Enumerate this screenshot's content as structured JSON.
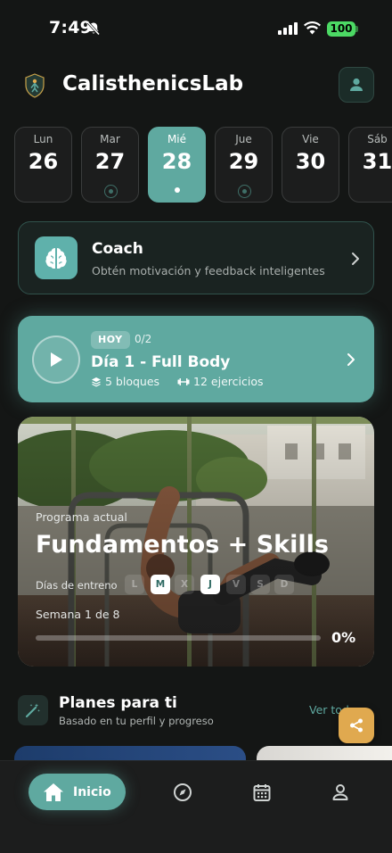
{
  "status_bar": {
    "time": "7:49",
    "battery": "100"
  },
  "header": {
    "title": "CalisthenicsLab"
  },
  "days": [
    {
      "name": "Lun",
      "number": "26",
      "marker": "none"
    },
    {
      "name": "Mar",
      "number": "27",
      "marker": "ring"
    },
    {
      "name": "Mié",
      "number": "28",
      "marker": "dot",
      "active": true
    },
    {
      "name": "Jue",
      "number": "29",
      "marker": "ring"
    },
    {
      "name": "Vie",
      "number": "30",
      "marker": "none"
    },
    {
      "name": "Sáb",
      "number": "31",
      "marker": "none"
    }
  ],
  "coach": {
    "title": "Coach",
    "subtitle": "Obtén motivación y feedback inteligentes"
  },
  "today": {
    "badge": "HOY",
    "progress": "0/2",
    "title": "Día 1 - Full Body",
    "blocks": "5 bloques",
    "exercises": "12 ejercicios"
  },
  "program": {
    "label": "Programa actual",
    "title": "Fundamentos + Skills",
    "days_label": "Días de entreno",
    "days": [
      {
        "letter": "L",
        "on": false
      },
      {
        "letter": "M",
        "on": true
      },
      {
        "letter": "X",
        "on": false
      },
      {
        "letter": "J",
        "on": true
      },
      {
        "letter": "V",
        "on": false
      },
      {
        "letter": "S",
        "on": false
      },
      {
        "letter": "D",
        "on": false
      }
    ],
    "week": "Semana 1 de 8",
    "progress_pct": "0%",
    "progress_value": 0
  },
  "plans": {
    "title": "Planes para ti",
    "subtitle": "Basado en tu perfil y progreso",
    "see_all": "Ver todo"
  },
  "nav": {
    "home_label": "Inicio"
  },
  "colors": {
    "accent": "#5fa9a0",
    "background": "#141615",
    "share": "#e0a94f"
  }
}
